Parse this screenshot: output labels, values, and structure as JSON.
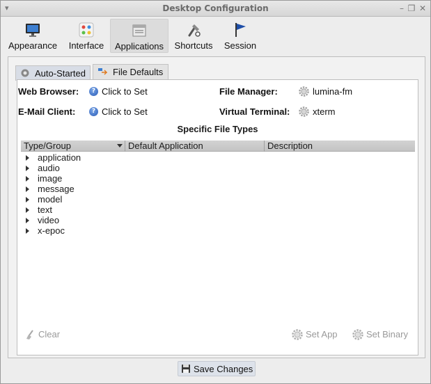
{
  "window": {
    "title": "Desktop Configuration",
    "menu_icon": "window-menu-icon",
    "controls": [
      "minimize-icon",
      "maximize-icon",
      "close-icon"
    ]
  },
  "toolbar": {
    "items": [
      {
        "label": "Appearance",
        "icon": "monitor-icon",
        "active": false
      },
      {
        "label": "Interface",
        "icon": "palette-icon",
        "active": false
      },
      {
        "label": "Applications",
        "icon": "window-icon",
        "active": true
      },
      {
        "label": "Shortcuts",
        "icon": "keyboard-shortcut-icon",
        "active": false
      },
      {
        "label": "Session",
        "icon": "flag-icon",
        "active": false
      }
    ]
  },
  "tabs": [
    {
      "label": "Auto-Started",
      "icon": "gear-run-icon",
      "active": true
    },
    {
      "label": "File Defaults",
      "icon": "file-defaults-icon",
      "active": false
    }
  ],
  "defaults": {
    "web_browser": {
      "label": "Web Browser:",
      "value": "Click to Set",
      "icon": "help-icon"
    },
    "email_client": {
      "label": "E-Mail Client:",
      "value": "Click to Set",
      "icon": "help-icon"
    },
    "file_manager": {
      "label": "File Manager:",
      "value": "lumina-fm",
      "icon": "gear-icon"
    },
    "virtual_terminal": {
      "label": "Virtual Terminal:",
      "value": "xterm",
      "icon": "gear-icon"
    }
  },
  "file_types": {
    "title": "Specific File Types",
    "columns": [
      "Type/Group",
      "Default Application",
      "Description"
    ],
    "rows": [
      "application",
      "audio",
      "image",
      "message",
      "model",
      "text",
      "video",
      "x-epoc"
    ]
  },
  "actions": {
    "clear": "Clear",
    "set_app": "Set App",
    "set_binary": "Set Binary"
  },
  "save": {
    "label": "Save Changes",
    "icon": "save-icon"
  },
  "colors": {
    "active_tab": "#d8dde6",
    "save_button": "#dde2ea",
    "header": "#c8c8c8",
    "disabled_text": "#9a9a9a"
  }
}
